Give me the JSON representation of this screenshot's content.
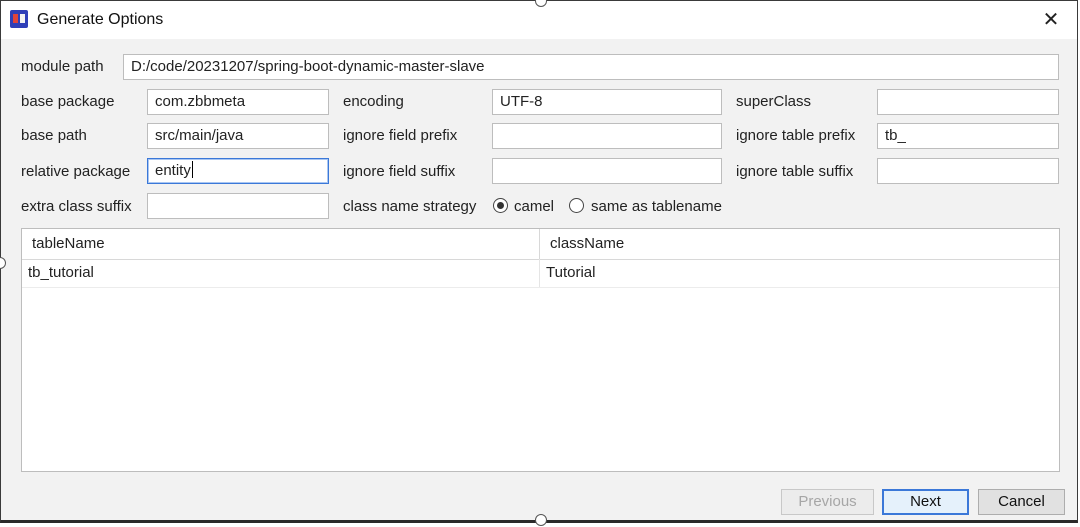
{
  "window": {
    "title": "Generate Options",
    "app_icon": "intellij-plugin-icon",
    "close_icon": "close-icon"
  },
  "form": {
    "module_path": {
      "label": "module path",
      "value": "D:/code/20231207/spring-boot-dynamic-master-slave"
    },
    "base_package": {
      "label": "base package",
      "value": "com.zbbmeta"
    },
    "base_path": {
      "label": "base path",
      "value": "src/main/java"
    },
    "relative_package": {
      "label": "relative package",
      "value": "entity"
    },
    "extra_class_suffix": {
      "label": "extra class suffix",
      "value": ""
    },
    "encoding": {
      "label": "encoding",
      "value": "UTF-8"
    },
    "ignore_field_prefix": {
      "label": "ignore field prefix",
      "value": ""
    },
    "ignore_field_suffix": {
      "label": "ignore field suffix",
      "value": ""
    },
    "class_name_strategy": {
      "label": "class name strategy",
      "options": [
        {
          "label": "camel",
          "selected": true
        },
        {
          "label": "same as tablename",
          "selected": false
        }
      ]
    },
    "super_class": {
      "label": "superClass",
      "value": ""
    },
    "ignore_table_prefix": {
      "label": "ignore table prefix",
      "value": "tb_"
    },
    "ignore_table_suffix": {
      "label": "ignore table suffix",
      "value": ""
    }
  },
  "table": {
    "columns": [
      "tableName",
      "className"
    ],
    "rows": [
      [
        "tb_tutorial",
        "Tutorial"
      ]
    ]
  },
  "buttons": {
    "previous": "Previous",
    "next": "Next",
    "cancel": "Cancel"
  },
  "colors": {
    "focus_border": "#3b78d8",
    "dialog_background": "#f2f2f2",
    "disabled_text": "#a6a6a6"
  }
}
